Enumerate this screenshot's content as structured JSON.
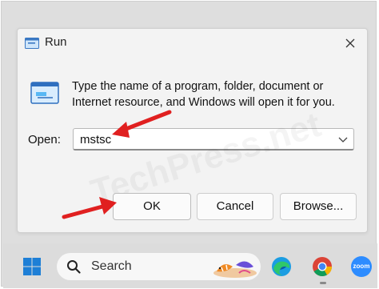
{
  "dialog": {
    "title": "Run",
    "description": "Type the name of a program, folder, document or Internet resource, and Windows will open it for you.",
    "open_label": "Open:",
    "open_value": "mstsc",
    "buttons": {
      "ok": "OK",
      "cancel": "Cancel",
      "browse": "Browse..."
    }
  },
  "watermark": "TechPress.net",
  "taskbar": {
    "search_placeholder": "Search",
    "apps": [
      {
        "name": "edge-icon"
      },
      {
        "name": "chrome-icon"
      },
      {
        "name": "zoom-icon",
        "label": "zoom"
      }
    ]
  },
  "annotations": {
    "arrow_color": "#e02020"
  },
  "colors": {
    "accent": "#0067c0",
    "dialog_bg": "#f3f3f3",
    "taskbar_bg": "#dcdcdc"
  }
}
